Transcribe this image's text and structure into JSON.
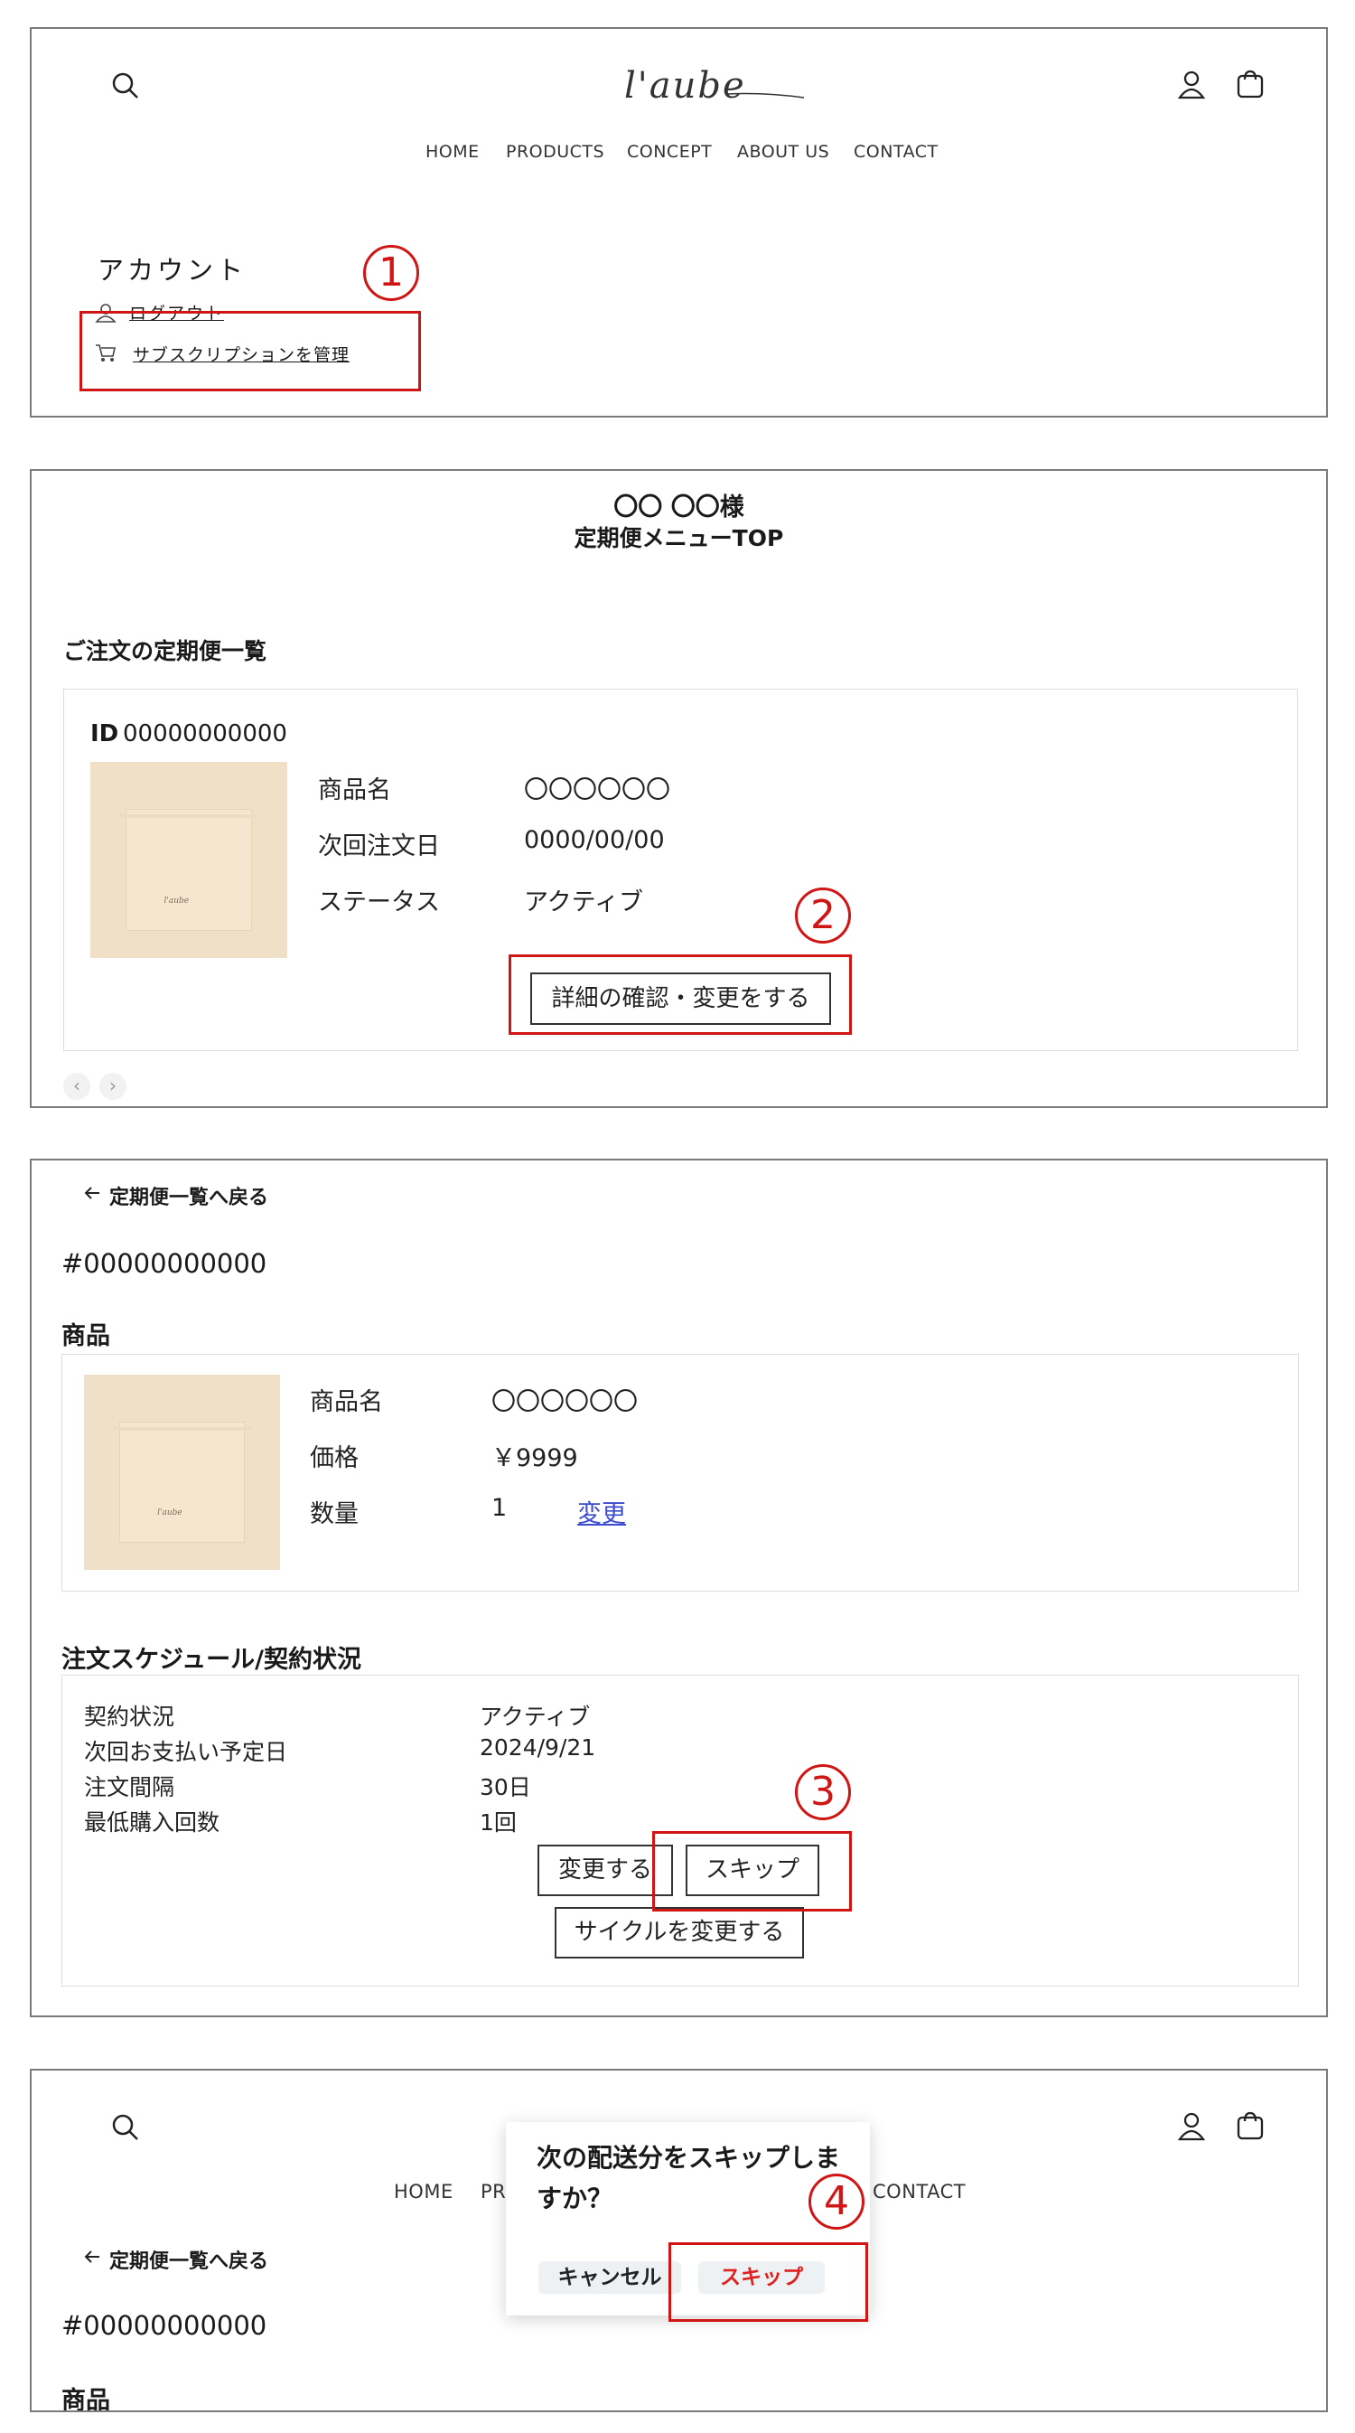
{
  "header": {
    "logo_text": "l'aube",
    "nav": [
      "HOME",
      "PRODUCTS",
      "CONCEPT",
      "ABOUT US",
      "CONTACT"
    ]
  },
  "account": {
    "title": "アカウント",
    "logout": "ログアウト",
    "manage_subscription": "サブスクリプションを管理"
  },
  "markers": [
    "1",
    "2",
    "3",
    "4"
  ],
  "subscription_top": {
    "customer_name": "〇〇 〇〇様",
    "menu_title": "定期便メニューTOP",
    "list_heading": "ご注文の定期便一覧",
    "id_label": "ID",
    "id_value": "00000000000",
    "rows": [
      {
        "label": "商品名",
        "value": "〇〇〇〇〇〇"
      },
      {
        "label": "次回注文日",
        "value": "0000/00/00"
      },
      {
        "label": "ステータス",
        "value": "アクティブ"
      }
    ],
    "detail_button": "詳細の確認・変更をする",
    "pager_prev": "‹",
    "pager_next": "›"
  },
  "detail": {
    "back_link": "定期便一覧へ戻る",
    "order_number": "#00000000000",
    "product_heading": "商品",
    "product_rows": [
      {
        "label": "商品名",
        "value": "〇〇〇〇〇〇"
      },
      {
        "label": "価格",
        "value": "￥9999"
      },
      {
        "label": "数量",
        "value": "1"
      }
    ],
    "change_link": "変更",
    "schedule_heading": "注文スケジュール/契約状況",
    "schedule_rows": [
      {
        "label": "契約状況",
        "value": "アクティブ"
      },
      {
        "label": "次回お支払い予定日",
        "value": "2024/9/21"
      },
      {
        "label": "注文間隔",
        "value": "30日"
      },
      {
        "label": "最低購入回数",
        "value": "1回"
      }
    ],
    "change_button": "変更する",
    "skip_button": "スキップ",
    "cycle_button": "サイクルを変更する"
  },
  "modal": {
    "question": "次の配送分をスキップしますか？",
    "cancel": "キャンセル",
    "skip": "スキップ"
  },
  "colors": {
    "annotation_red": "#d01515",
    "link_blue": "#3b4ccf",
    "panel_border": "#7a7a7a",
    "skip_red": "#e0201e"
  }
}
